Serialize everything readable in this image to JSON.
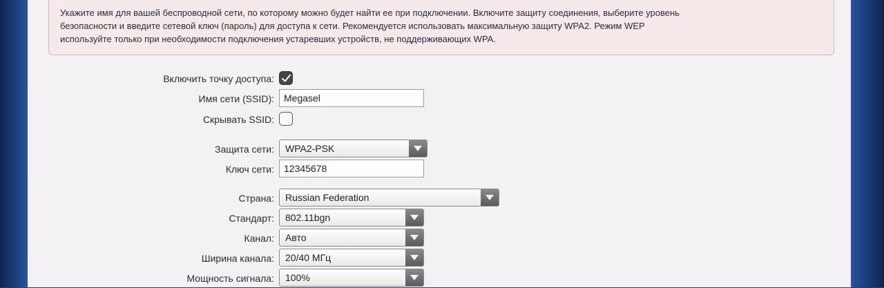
{
  "info": {
    "line1": "Укажите имя для вашей беспроводной сети, по которому можно будет найти ее при подключении. Включите защиту соединения, выберите уровень",
    "line2": "безопасности и введите сетевой ключ (пароль) для доступа к сети. Рекомендуется использовать максимальную защиту WPA2. Режим WEP",
    "line3": "используйте только при необходимости подключения устаревших устройств, не поддерживающих WPA."
  },
  "form": {
    "enable_ap": {
      "label": "Включить точку доступа:",
      "checked": true
    },
    "ssid": {
      "label": "Имя сети (SSID):",
      "value": "Megasel"
    },
    "hide_ssid": {
      "label": "Скрывать SSID:",
      "checked": false
    },
    "security": {
      "label": "Защита сети:",
      "value": "WPA2-PSK"
    },
    "key": {
      "label": "Ключ сети:",
      "value": "12345678"
    },
    "country": {
      "label": "Страна:",
      "value": "Russian Federation"
    },
    "standard": {
      "label": "Стандарт:",
      "value": "802.11bgn"
    },
    "channel": {
      "label": "Канал:",
      "value": "Авто"
    },
    "width": {
      "label": "Ширина канала:",
      "value": "20/40 МГц"
    },
    "power": {
      "label": "Мощность сигнала:",
      "value": "100%"
    }
  }
}
